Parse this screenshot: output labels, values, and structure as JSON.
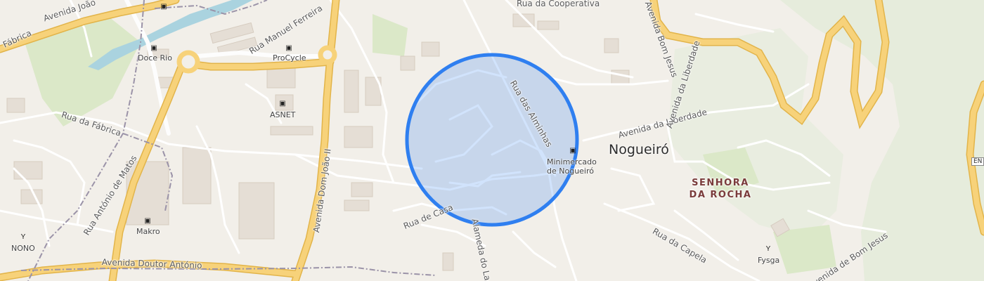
{
  "map": {
    "place_name": "Nogueiró",
    "district_name_line1": "SENHORA",
    "district_name_line2": "DA ROCHA",
    "location_marker_color": "#2f7ff0",
    "location_fill_color": "rgba(47,127,240,0.22)",
    "streets": {
      "avenida_joao": "Avenida João",
      "fabrica_top": "Fábrica",
      "rua_manuel_ferreira": "Rua Manuel Ferreira",
      "rua_da_cooperativa": "Rua da Cooperativa",
      "avenida_bom_jesus": "Avenida Bom Jesus",
      "rua_da_fabrica": "Rua da Fábrica",
      "rua_antonio_de_matos": "Rua António de Matos",
      "avenida_dom_joao_ii": "Avenida Dom João II",
      "rua_das_alminhas": "Rua das Alminhas",
      "avenida_da_liberdade": "Avenida da Liberdade",
      "rua_de_casa": "Rua de Casa",
      "alameda_do_la": "Alameda do La",
      "rua_da_capela": "Rua da Capela",
      "avenida_doutor_antonio": "Avenida Doutor António",
      "avenida_de_bom_jesus": "Avenida de Bom Jesus"
    },
    "pois": {
      "doce_rio": "Doce Rio",
      "procycle": "ProCycle",
      "asnet": "ASNET",
      "makro": "Makro",
      "nono": "NONO",
      "minimercado_line1": "Minimercado",
      "minimercado_line2": "de Nogueiró",
      "fysga": "Fysga"
    },
    "road_shield": "EN"
  }
}
